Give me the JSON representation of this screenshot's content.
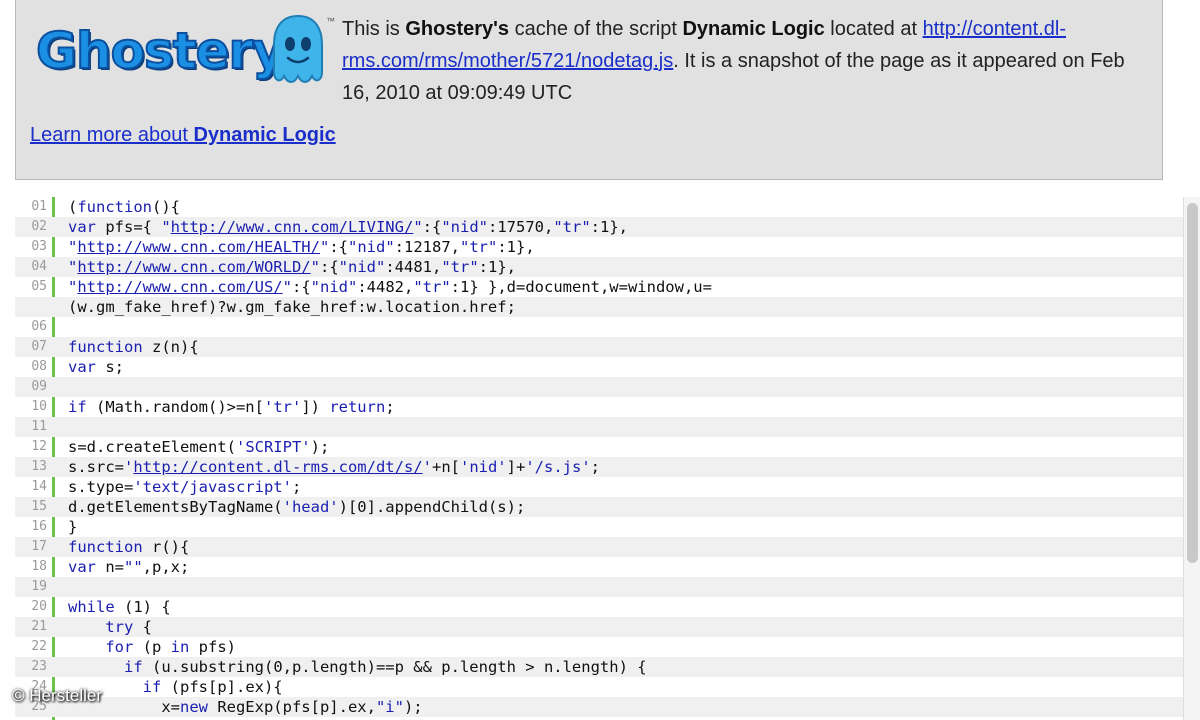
{
  "header": {
    "logo_text": "Ghostery",
    "cache_prefix": "This is ",
    "cache_brand": "Ghostery's",
    "cache_mid": " cache of the script ",
    "cache_script": "Dynamic Logic",
    "cache_located": " located at ",
    "cache_url": "http://content.dl-rms.com/rms/mother/5721/nodetag.js",
    "cache_suffix": ". It is a snapshot of the page as it appeared on Feb 16, 2010 at 09:09:49 UTC",
    "learn_prefix": "Learn more about ",
    "learn_target": "Dynamic Logic"
  },
  "code": {
    "lines": [
      {
        "n": "01",
        "t": "(function(){"
      },
      {
        "n": "02",
        "t": "var pfs={ \"http://www.cnn.com/LIVING/\":{\"nid\":17570,\"tr\":1},"
      },
      {
        "n": "03",
        "t": "\"http://www.cnn.com/HEALTH/\":{\"nid\":12187,\"tr\":1},"
      },
      {
        "n": "04",
        "t": "\"http://www.cnn.com/WORLD/\":{\"nid\":4481,\"tr\":1},"
      },
      {
        "n": "05",
        "t": "\"http://www.cnn.com/US/\":{\"nid\":4482,\"tr\":1} },d=document,w=window,u="
      },
      {
        "n": "",
        "t": "(w.gm_fake_href)?w.gm_fake_href:w.location.href;"
      },
      {
        "n": "06",
        "t": ""
      },
      {
        "n": "07",
        "t": "function z(n){"
      },
      {
        "n": "08",
        "t": "var s;"
      },
      {
        "n": "09",
        "t": ""
      },
      {
        "n": "10",
        "t": "if (Math.random()>=n['tr']) return;"
      },
      {
        "n": "11",
        "t": ""
      },
      {
        "n": "12",
        "t": "s=d.createElement('SCRIPT');"
      },
      {
        "n": "13",
        "t": "s.src='http://content.dl-rms.com/dt/s/'+n['nid']+'/s.js';"
      },
      {
        "n": "14",
        "t": "s.type='text/javascript';"
      },
      {
        "n": "15",
        "t": "d.getElementsByTagName('head')[0].appendChild(s);"
      },
      {
        "n": "16",
        "t": "}"
      },
      {
        "n": "17",
        "t": "function r(){"
      },
      {
        "n": "18",
        "t": "var n=\"\",p,x;"
      },
      {
        "n": "19",
        "t": ""
      },
      {
        "n": "20",
        "t": "while (1) {"
      },
      {
        "n": "21",
        "t": "    try {"
      },
      {
        "n": "22",
        "t": "    for (p in pfs)"
      },
      {
        "n": "23",
        "t": "      if (u.substring(0,p.length)==p && p.length > n.length) {"
      },
      {
        "n": "24",
        "t": "        if (pfs[p].ex){"
      },
      {
        "n": "25",
        "t": "          x=new RegExp(pfs[p].ex,\"i\");"
      },
      {
        "n": "26",
        "t": "          if (x.test(u))"
      }
    ]
  },
  "watermark": "© Hersteller",
  "colors": {
    "header_bg": "#e1e1e1",
    "link": "#1a2fc9",
    "gutter": "#6cc24a",
    "keyword": "#1b1fb0"
  }
}
